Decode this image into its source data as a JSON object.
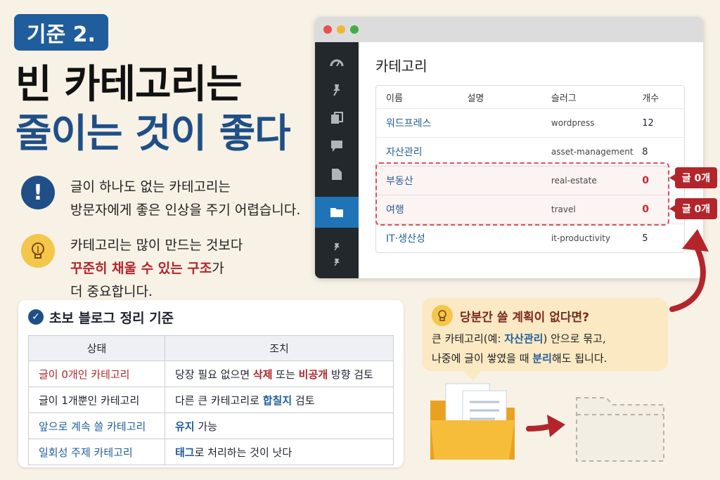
{
  "badge": "기준 2.",
  "headline": {
    "line1": "빈 카테고리는",
    "line2": "줄이는 것이 좋다"
  },
  "tip1": {
    "icon": "exclamation-icon",
    "line1": "글이 하나도 없는 카테고리는",
    "line2": "방문자에게 좋은 인상을 주기 어렵습니다."
  },
  "tip2": {
    "icon": "lightbulb-icon",
    "line1": "카테고리는 많이 만드는 것보다",
    "line2_em": "꾸준히 채울 수 있는 구조",
    "line2_rest": "가",
    "line3": "더 중요합니다."
  },
  "card": {
    "title": "초보 블로그 정리 기준",
    "headers": [
      "상태",
      "조치"
    ],
    "rows": [
      {
        "state": "글이 0개인 카테고리",
        "a1": "당장 필요 없으면 ",
        "e1": "삭제",
        "a2": " 또는 ",
        "e2": "비공개",
        "a3": " 방향 검토"
      },
      {
        "state": "글이 1개뿐인 카테고리",
        "a1": "다른 큰 카테고리로 ",
        "e1": "합칠지",
        "a2": " 검토"
      },
      {
        "state": "앞으로 계속 쓸 카테고리",
        "e1": "유지",
        "a2": " 가능"
      },
      {
        "state": "일회성 주제 카테고리",
        "e1": "태그",
        "a2": "로 처리하는 것이 낫다"
      }
    ]
  },
  "window": {
    "title": "카테고리",
    "columns": [
      "이름",
      "설명",
      "슬러그",
      "개수"
    ],
    "rows": [
      {
        "name": "워드프레스",
        "slug": "wordpress",
        "count": "12"
      },
      {
        "name": "자산관리",
        "slug": "asset-management",
        "count": "8"
      },
      {
        "name": "부동산",
        "slug": "real-estate",
        "count": "0"
      },
      {
        "name": "여행",
        "slug": "travel",
        "count": "0"
      },
      {
        "name": "IT·생산성",
        "slug": "it-productivity",
        "count": "5"
      }
    ],
    "tag": "글 0개"
  },
  "bubble": {
    "title": "당분간 쓸 계획이 없다면?",
    "line1_a": "큰 카테고리(예: ",
    "line1_em": "자산관리",
    "line1_b": ") 안으로 묶고,",
    "line2_a": "나중에 글이 쌓였을 때 ",
    "line2_em": "분리",
    "line2_b": "해도 됩니다."
  },
  "colors": {
    "brand_blue": "#1f5d9c",
    "alert_red": "#b3252a",
    "accent_yellow": "#f4c64a"
  }
}
